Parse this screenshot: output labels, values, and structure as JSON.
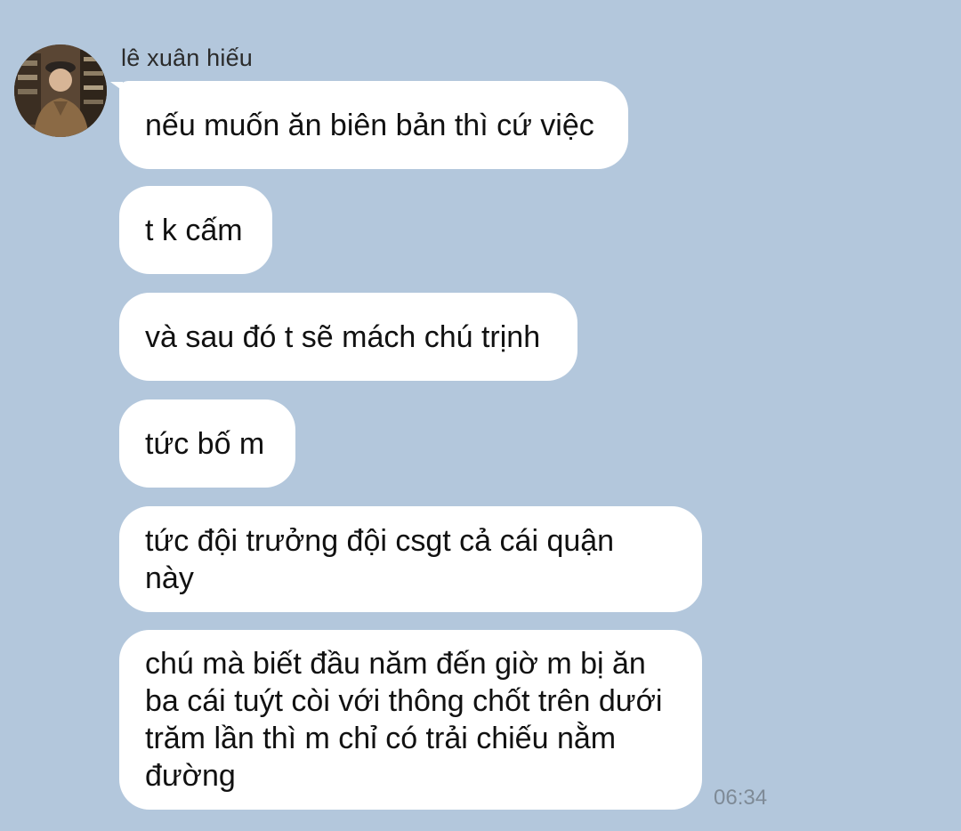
{
  "chat": {
    "sender": {
      "name": "lê xuân hiếu",
      "avatar_icon": "profile-photo"
    },
    "messages": [
      "nếu muốn ăn biên bản thì cứ việc",
      "t k cấm",
      "và sau đó t sẽ mách chú trịnh",
      "tức bố m",
      "tức đội trưởng đội csgt cả cái quận\nnày",
      "chú mà biết đầu năm đến giờ m bị ăn\nba cái tuýt còi với thông chốt trên dưới\ntrăm lần thì m chỉ có trải chiếu nằm\nđường"
    ],
    "last_timestamp": "06:34"
  },
  "colors": {
    "background": "#b3c7dc",
    "bubble": "#ffffff",
    "timestamp": "#7e8a96"
  }
}
